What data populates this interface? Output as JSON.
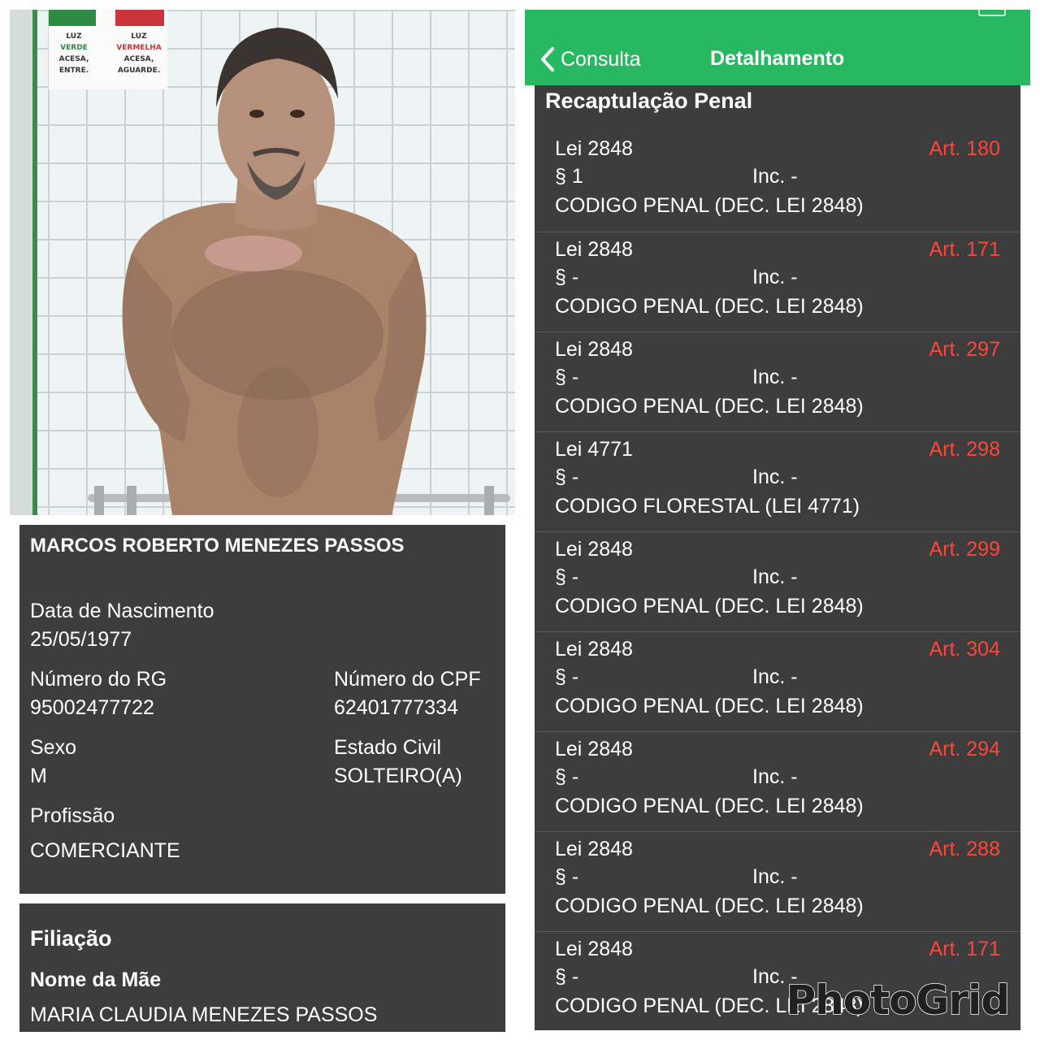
{
  "photo": {
    "sign": {
      "left": [
        "LUZ",
        "VERDE",
        "ACESA,",
        "ENTRE."
      ],
      "right": [
        "LUZ",
        "VERMELHA",
        "ACESA,",
        "AGUARDE."
      ]
    }
  },
  "profile": {
    "name": "MARCOS ROBERTO MENEZES PASSOS",
    "birth_label": "Data de Nascimento",
    "birth_value": "25/05/1977",
    "rg_label": "Número do RG",
    "rg_value": "95002477722",
    "cpf_label": "Número do CPF",
    "cpf_value": "62401777334",
    "sex_label": "Sexo",
    "sex_value": "M",
    "civil_label": "Estado Civil",
    "civil_value": "SOLTEIRO(A)",
    "job_label": "Profissão",
    "job_value": "COMERCIANTE"
  },
  "filiacao": {
    "title": "Filiação",
    "mother_label": "Nome da Mãe",
    "mother_value": "MARIA CLAUDIA MENEZES PASSOS"
  },
  "nav": {
    "back_label": "Consulta",
    "title": "Detalhamento"
  },
  "recap": {
    "title": "Recaptulação Penal",
    "items": [
      {
        "lei": "Lei 2848",
        "art": "Art. 180",
        "par": "§ 1",
        "inc": "Inc. -",
        "code": "CODIGO PENAL (DEC. LEI 2848)"
      },
      {
        "lei": "Lei 2848",
        "art": "Art. 171",
        "par": "§ -",
        "inc": "Inc. -",
        "code": "CODIGO PENAL (DEC. LEI 2848)"
      },
      {
        "lei": "Lei 2848",
        "art": "Art. 297",
        "par": "§ -",
        "inc": "Inc. -",
        "code": "CODIGO PENAL (DEC. LEI 2848)"
      },
      {
        "lei": "Lei 4771",
        "art": "Art. 298",
        "par": "§ -",
        "inc": "Inc. -",
        "code": "CODIGO FLORESTAL (LEI 4771)"
      },
      {
        "lei": "Lei 2848",
        "art": "Art. 299",
        "par": "§ -",
        "inc": "Inc. -",
        "code": "CODIGO PENAL (DEC. LEI 2848)"
      },
      {
        "lei": "Lei 2848",
        "art": "Art. 304",
        "par": "§ -",
        "inc": "Inc. -",
        "code": "CODIGO PENAL (DEC. LEI 2848)"
      },
      {
        "lei": "Lei 2848",
        "art": "Art. 294",
        "par": "§ -",
        "inc": "Inc. -",
        "code": "CODIGO PENAL (DEC. LEI 2848)"
      },
      {
        "lei": "Lei 2848",
        "art": "Art. 288",
        "par": "§ -",
        "inc": "Inc. -",
        "code": "CODIGO PENAL (DEC. LEI 2848)"
      },
      {
        "lei": "Lei 2848",
        "art": "Art. 171",
        "par": "§ -",
        "inc": "Inc. -",
        "code": "CODIGO PENAL (DEC. LEI 2848)"
      }
    ]
  },
  "watermark": "PhotoGrid",
  "colors": {
    "nav_green": "#28b862",
    "card_bg": "#3d3d3d",
    "article_red": "#ff453a"
  },
  "icons": {
    "back": "chevron-left-icon"
  }
}
